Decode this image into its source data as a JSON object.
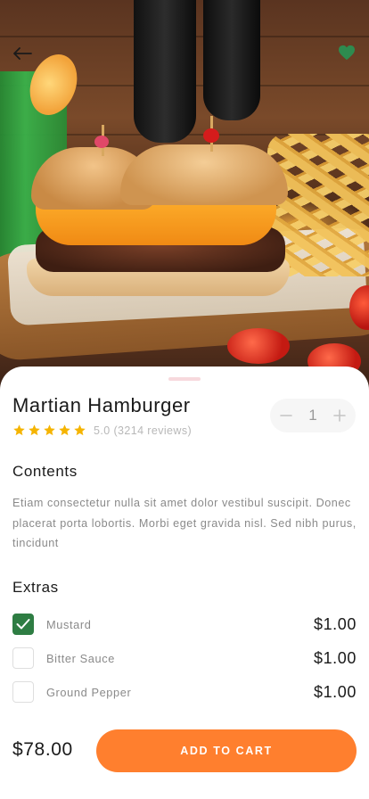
{
  "product": {
    "name": "Martian Hamburger",
    "rating_value": 5,
    "rating_text": "5.0 (3214 reviews)"
  },
  "quantity": {
    "value": "1",
    "decrement_icon": "minus-icon",
    "increment_icon": "plus-icon"
  },
  "header": {
    "back_icon": "arrow-left-icon",
    "favorite_icon": "heart-icon",
    "favorite_color": "#2e8b4f"
  },
  "contents": {
    "title": "Contents",
    "text": "Etiam consectetur nulla sit amet dolor vestibul suscipit. Donec placerat porta lobortis. Morbi eget gravida nisl. Sed nibh purus, tincidunt"
  },
  "extras": {
    "title": "Extras",
    "items": [
      {
        "label": "Mustard",
        "price": "$1.00",
        "checked": true
      },
      {
        "label": "Bitter Sauce",
        "price": "$1.00",
        "checked": false
      },
      {
        "label": "Ground Pepper",
        "price": "$1.00",
        "checked": false
      }
    ]
  },
  "footer": {
    "total": "$78.00",
    "add_to_cart": "ADD TO CART"
  },
  "colors": {
    "accent": "#ff7f2e",
    "checkbox_checked": "#2e7d43",
    "star": "#f5b400"
  }
}
